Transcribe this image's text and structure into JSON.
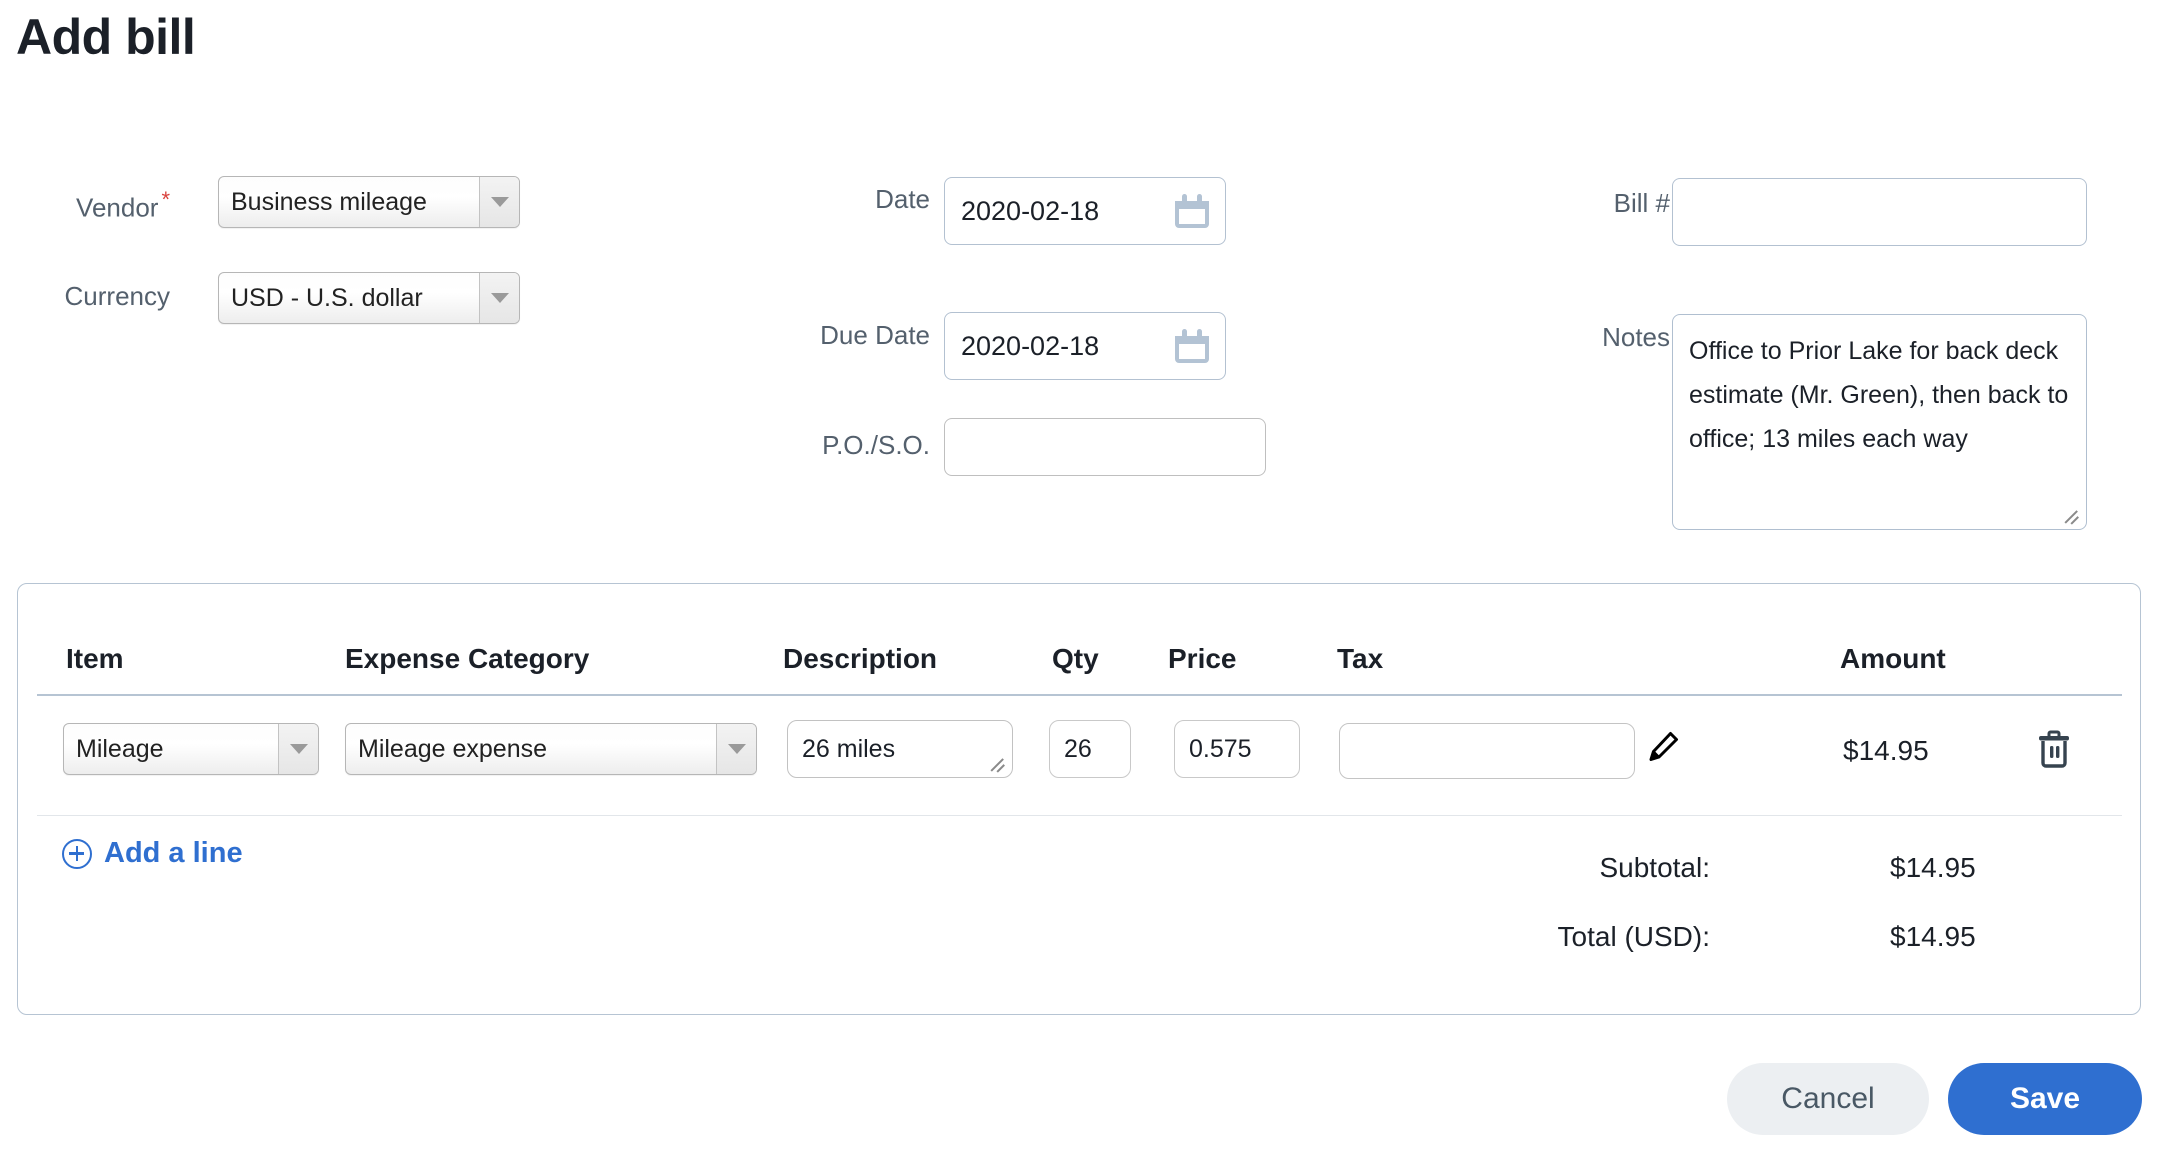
{
  "page": {
    "title": "Add bill"
  },
  "form": {
    "vendor": {
      "label": "Vendor",
      "required_marker": "*",
      "value": "Business mileage"
    },
    "currency": {
      "label": "Currency",
      "value": "USD - U.S. dollar"
    },
    "date": {
      "label": "Date",
      "value": "2020-02-18"
    },
    "due_date": {
      "label": "Due Date",
      "value": "2020-02-18"
    },
    "po_so": {
      "label": "P.O./S.O.",
      "value": ""
    },
    "bill_number": {
      "label": "Bill #",
      "value": ""
    },
    "notes": {
      "label": "Notes",
      "value": "Office to Prior Lake for back deck estimate (Mr. Green), then back to office; 13 miles each way"
    }
  },
  "lines": {
    "columns": {
      "item": "Item",
      "expense_category": "Expense Category",
      "description": "Description",
      "qty": "Qty",
      "price": "Price",
      "tax": "Tax",
      "amount": "Amount"
    },
    "rows": [
      {
        "item": "Mileage",
        "expense_category": "Mileage expense",
        "description": "26 miles",
        "qty": "26",
        "price": "0.575",
        "tax": "",
        "amount": "$14.95"
      }
    ],
    "add_line_label": "Add a line"
  },
  "totals": {
    "subtotal_label": "Subtotal:",
    "subtotal_value": "$14.95",
    "total_label": "Total (USD):",
    "total_value": "$14.95"
  },
  "actions": {
    "cancel": "Cancel",
    "save": "Save"
  },
  "colors": {
    "accent": "#2f6fd0",
    "label": "#54606d",
    "required": "#d9413c",
    "card_border": "#b6c4d3",
    "icon_muted": "#b3c3d4",
    "trash": "#36434f"
  }
}
